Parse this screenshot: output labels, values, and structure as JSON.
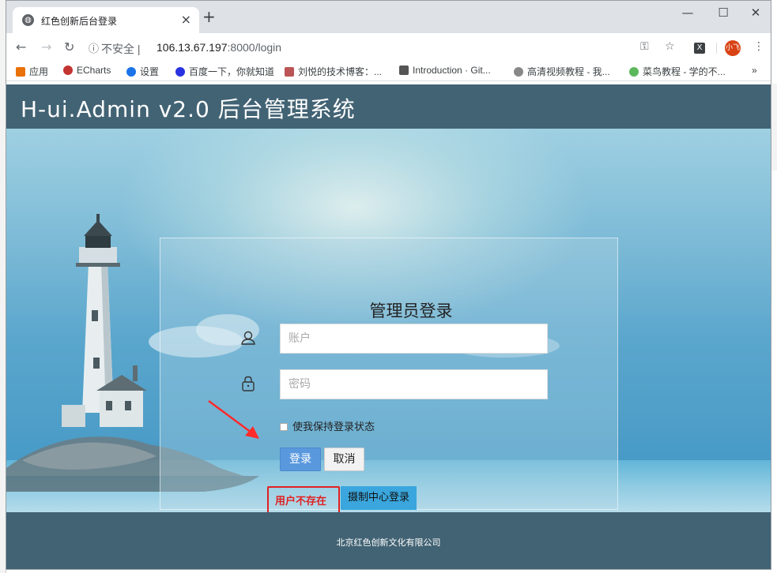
{
  "browser": {
    "tab_title": "红色创新后台登录",
    "tab_close": "×",
    "new_tab": "+",
    "security_label": "不安全",
    "url_host": "106.13.67.197",
    "url_rest": ":8000/login",
    "window_controls": [
      "—",
      "☐",
      "✕"
    ],
    "avatar_label": "小飞",
    "ext_label": "X"
  },
  "bookmarks": [
    {
      "label": "应用",
      "icon_color": "#1a73e8"
    },
    {
      "label": "ECharts",
      "icon_color": "#c23531"
    },
    {
      "label": "设置",
      "icon_color": "#1a73e8"
    },
    {
      "label": "百度一下，你就知道",
      "icon_color": "#2932e1"
    },
    {
      "label": "刘悦的技术博客：...",
      "icon_color": "#b55"
    },
    {
      "label": "Introduction · Git...",
      "icon_color": "#555"
    },
    {
      "label": "高清视频教程 - 我...",
      "icon_color": "#888"
    },
    {
      "label": "菜鸟教程 - 学的不...",
      "icon_color": "#5cb85c"
    }
  ],
  "bookmark_more": "»",
  "header": {
    "title": "H-ui.Admin v2.0 后台管理系统"
  },
  "login": {
    "title": "管理员登录",
    "account_placeholder": "账户",
    "password_placeholder": "密码",
    "remember_label": "使我保持登录状态",
    "login_button": "登录",
    "cancel_button": "取消",
    "error_text": "用户不存在",
    "sso_button": "摄制中心登录"
  },
  "footer": {
    "copyright": "北京红色创新文化有限公司"
  },
  "colors": {
    "header_bg": "#426374",
    "error": "#e02020",
    "primary": "#5a98de",
    "sso": "#3aa6dd"
  }
}
